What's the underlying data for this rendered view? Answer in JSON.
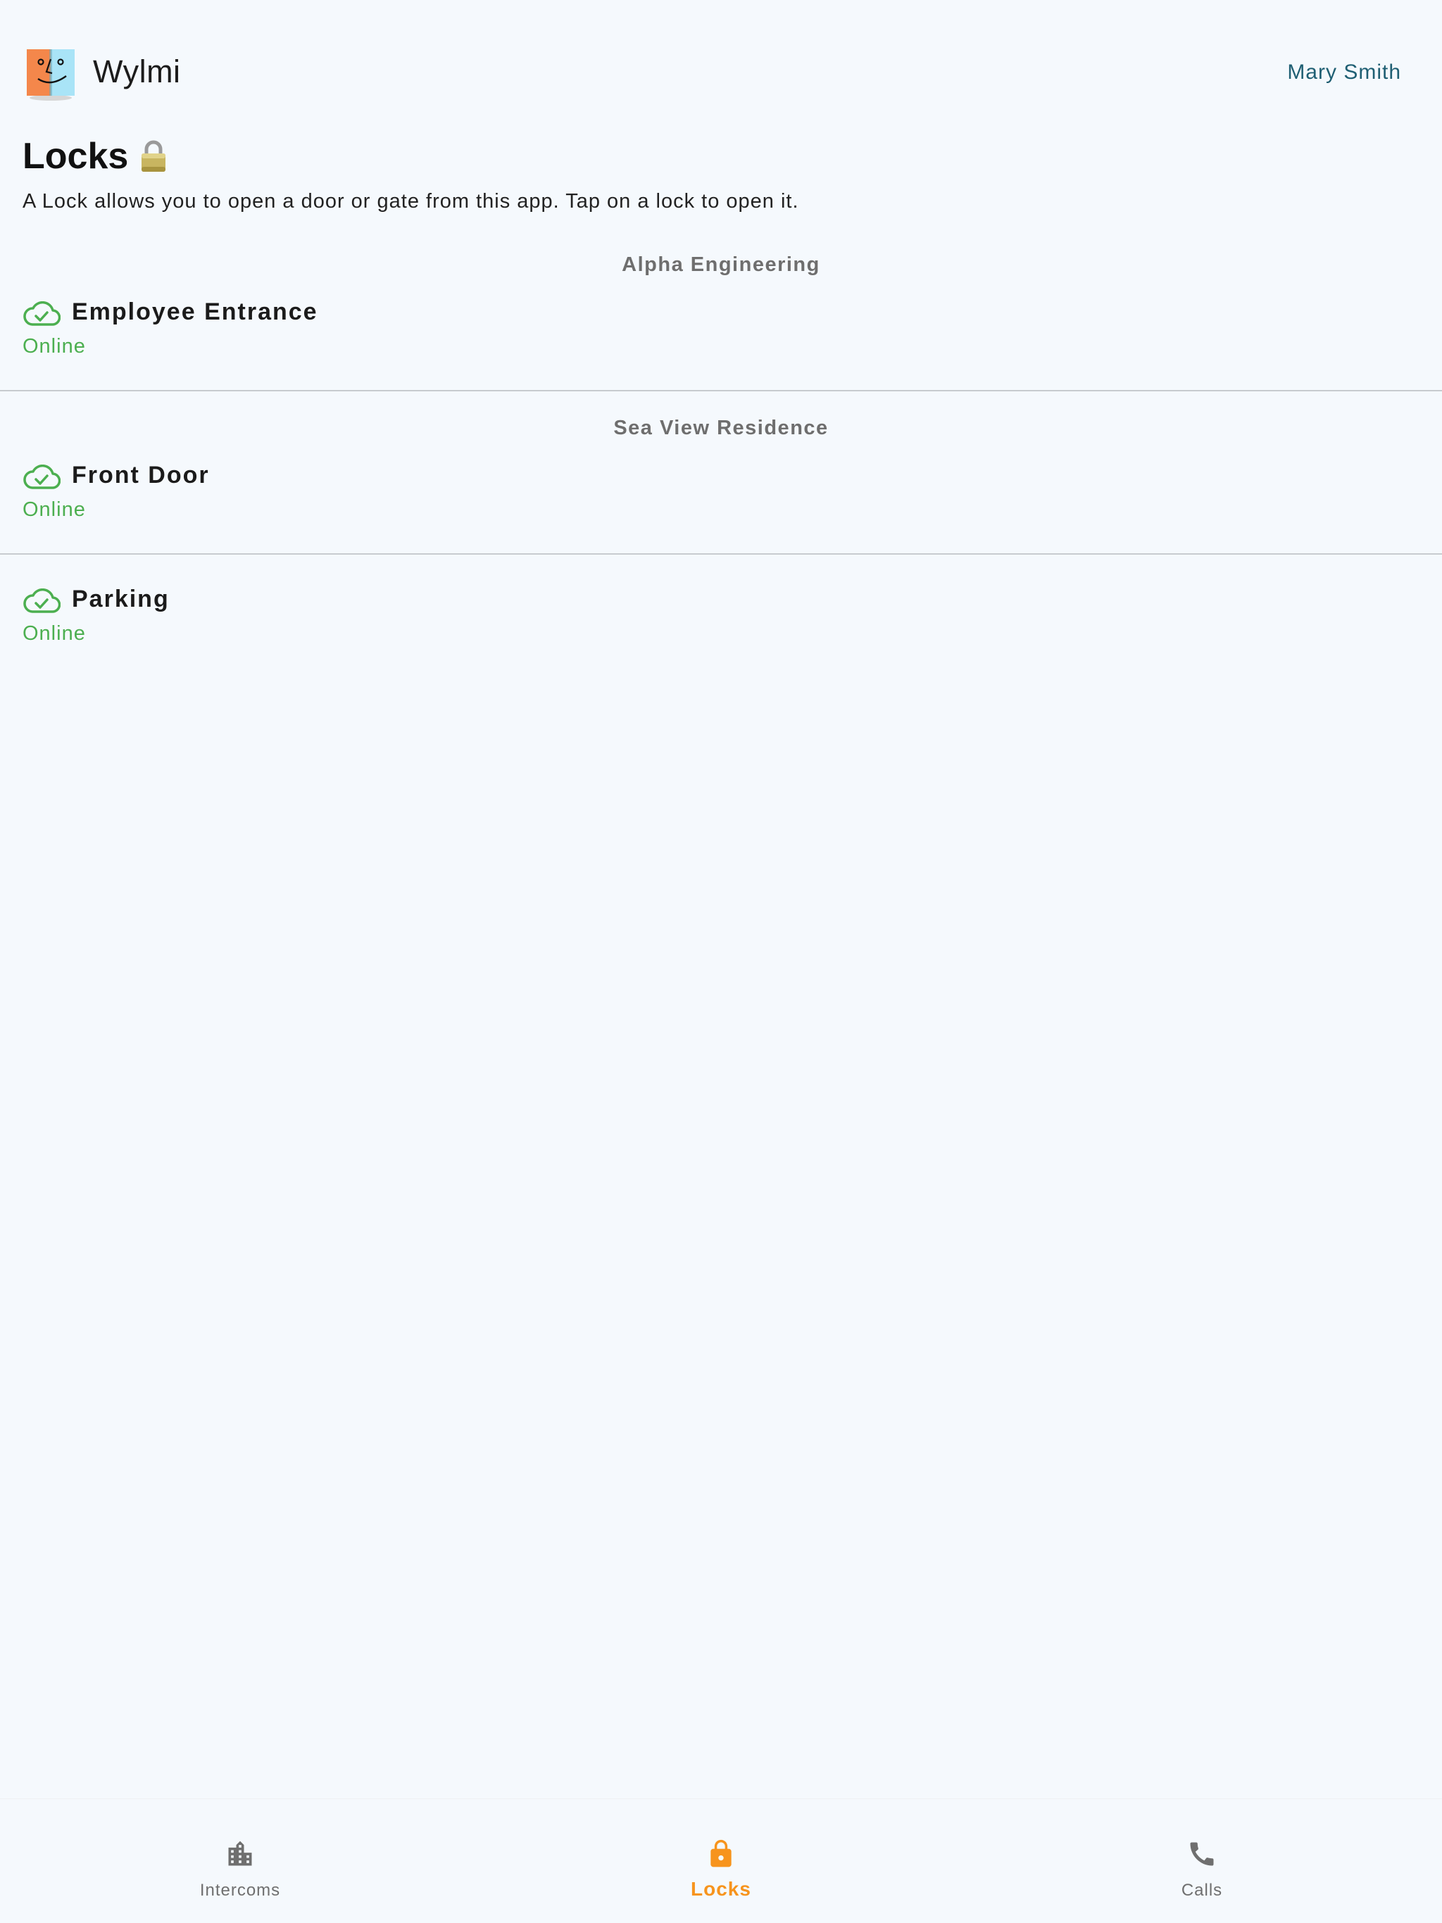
{
  "header": {
    "app_name": "Wylmi",
    "user_name": "Mary Smith"
  },
  "page": {
    "title": "Locks",
    "title_icon": "padlock-emoji",
    "description": "A Lock allows you to open a door or gate from this app. Tap on a lock to open it."
  },
  "groups": [
    {
      "name": "Alpha Engineering",
      "locks": [
        {
          "name": "Employee Entrance",
          "status": "Online",
          "icon": "cloud-check-icon"
        }
      ]
    },
    {
      "name": "Sea View Residence",
      "locks": [
        {
          "name": "Front Door",
          "status": "Online",
          "icon": "cloud-check-icon"
        },
        {
          "name": "Parking",
          "status": "Online",
          "icon": "cloud-check-icon"
        }
      ]
    }
  ],
  "bottom_nav": {
    "items": [
      {
        "label": "Intercoms",
        "icon": "building-icon",
        "active": false
      },
      {
        "label": "Locks",
        "icon": "lock-icon",
        "active": true
      },
      {
        "label": "Calls",
        "icon": "phone-icon",
        "active": false
      }
    ]
  },
  "colors": {
    "background": "#f5f9fd",
    "online_green": "#4caf50",
    "active_orange": "#f7941d",
    "user_link": "#1f5f73",
    "group_header": "#6e6e6e",
    "nav_inactive": "#6f6f6f"
  }
}
